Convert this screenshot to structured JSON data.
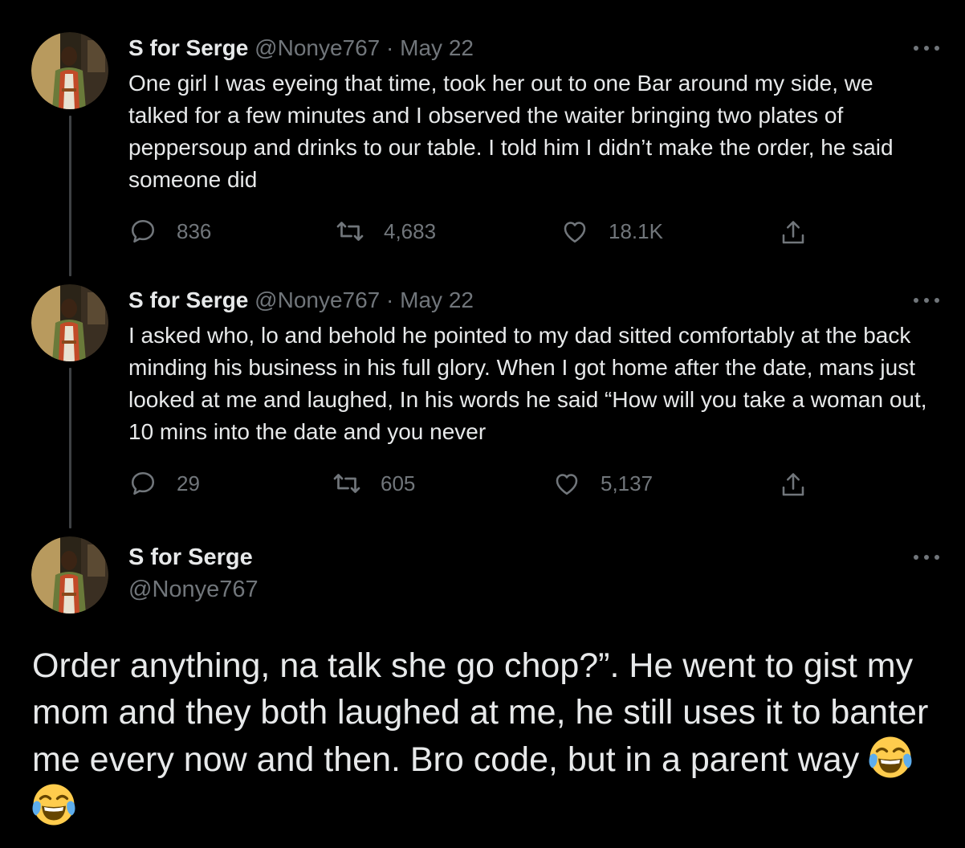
{
  "tweets": [
    {
      "name": "S for Serge",
      "handle": "@Nonye767",
      "separator": "·",
      "date": "May 22",
      "text": "One girl I was eyeing that time, took her out to one Bar around my side, we talked for a few minutes and I observed the waiter bringing two plates of peppersoup and drinks to our table. I told him I didn’t make the order, he said someone did",
      "replies": "836",
      "retweets": "4,683",
      "likes": "18.1K"
    },
    {
      "name": "S for Serge",
      "handle": "@Nonye767",
      "separator": "·",
      "date": "May 22",
      "text": "I asked who, lo and behold he pointed to my dad sitted comfortably at the back minding his business in his full glory. When I got home after the date, mans just looked at me and laughed, In his words he said “How will you take a woman out, 10 mins into the date and you never",
      "replies": "29",
      "retweets": "605",
      "likes": "5,137"
    }
  ],
  "main_tweet": {
    "name": "S for Serge",
    "handle": "@Nonye767",
    "text": "Order anything, na talk she go chop?”. He went to gist my mom and they both laughed at me, he still uses it to banter me every now and then. Bro code, but in a parent way",
    "emoji": "face-with-tears-of-joy x2"
  },
  "colors": {
    "background": "#000000",
    "text": "#e7e9ea",
    "secondary": "#71767b",
    "thread_line": "#3e4144"
  }
}
